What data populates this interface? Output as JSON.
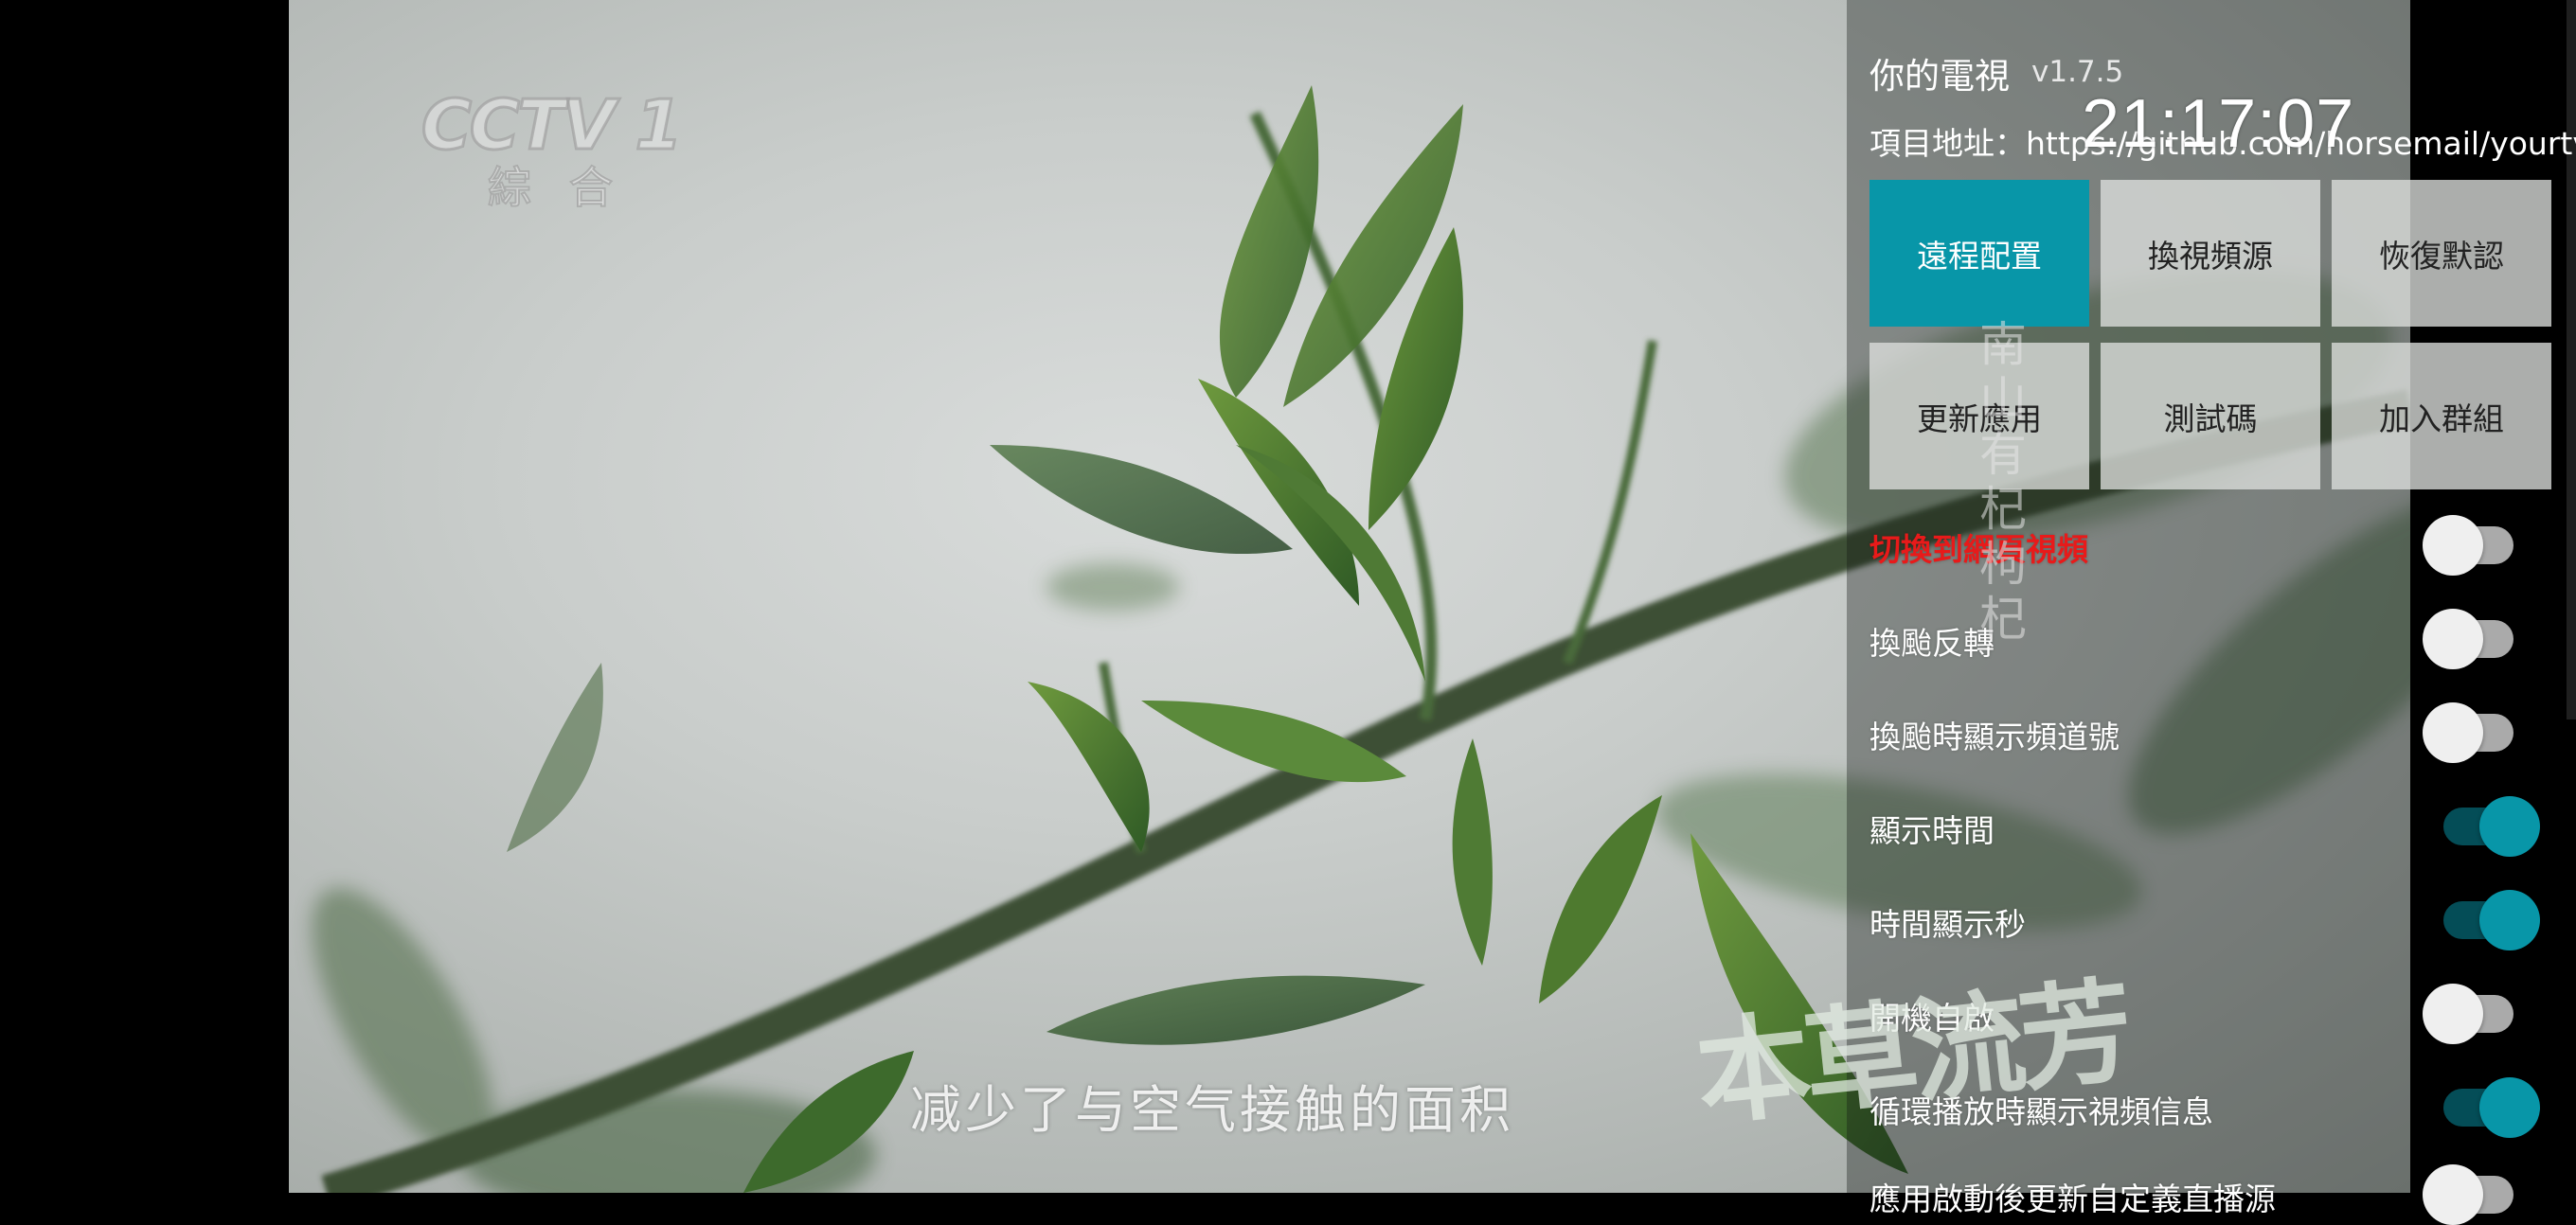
{
  "video": {
    "channel_logo": "CCTV 1",
    "channel_logo_sub": "綜合",
    "subtitle": "减少了与空气接触的面积",
    "vertical_caption": "南山有杞 枸杞",
    "program_logo": "本草流芳"
  },
  "panel": {
    "app_name": "你的電視",
    "version": "v1.7.5",
    "project_url": "項目地址：https://github.com/horsemail/yourtv",
    "clock": "21:17:07",
    "buttons": [
      {
        "label": "遠程配置",
        "active": true
      },
      {
        "label": "換視頻源",
        "active": false
      },
      {
        "label": "恢復默認",
        "active": false
      },
      {
        "label": "更新應用",
        "active": false
      },
      {
        "label": "測試碼",
        "active": false
      },
      {
        "label": "加入群組",
        "active": false
      }
    ],
    "toggles": [
      {
        "label": "切換到網頁視頻",
        "on": false
      },
      {
        "label": "換颱反轉",
        "on": false
      },
      {
        "label": "換颱時顯示頻道號",
        "on": false
      },
      {
        "label": "顯示時間",
        "on": true
      },
      {
        "label": "時間顯示秒",
        "on": true
      },
      {
        "label": "開機自啟",
        "on": false
      },
      {
        "label": "循環播放時顯示視頻信息",
        "on": true
      },
      {
        "label": "應用啟動後更新自定義直播源",
        "on": false
      }
    ]
  },
  "colors": {
    "accent": "#0896a8",
    "alert": "#e81a1a"
  }
}
